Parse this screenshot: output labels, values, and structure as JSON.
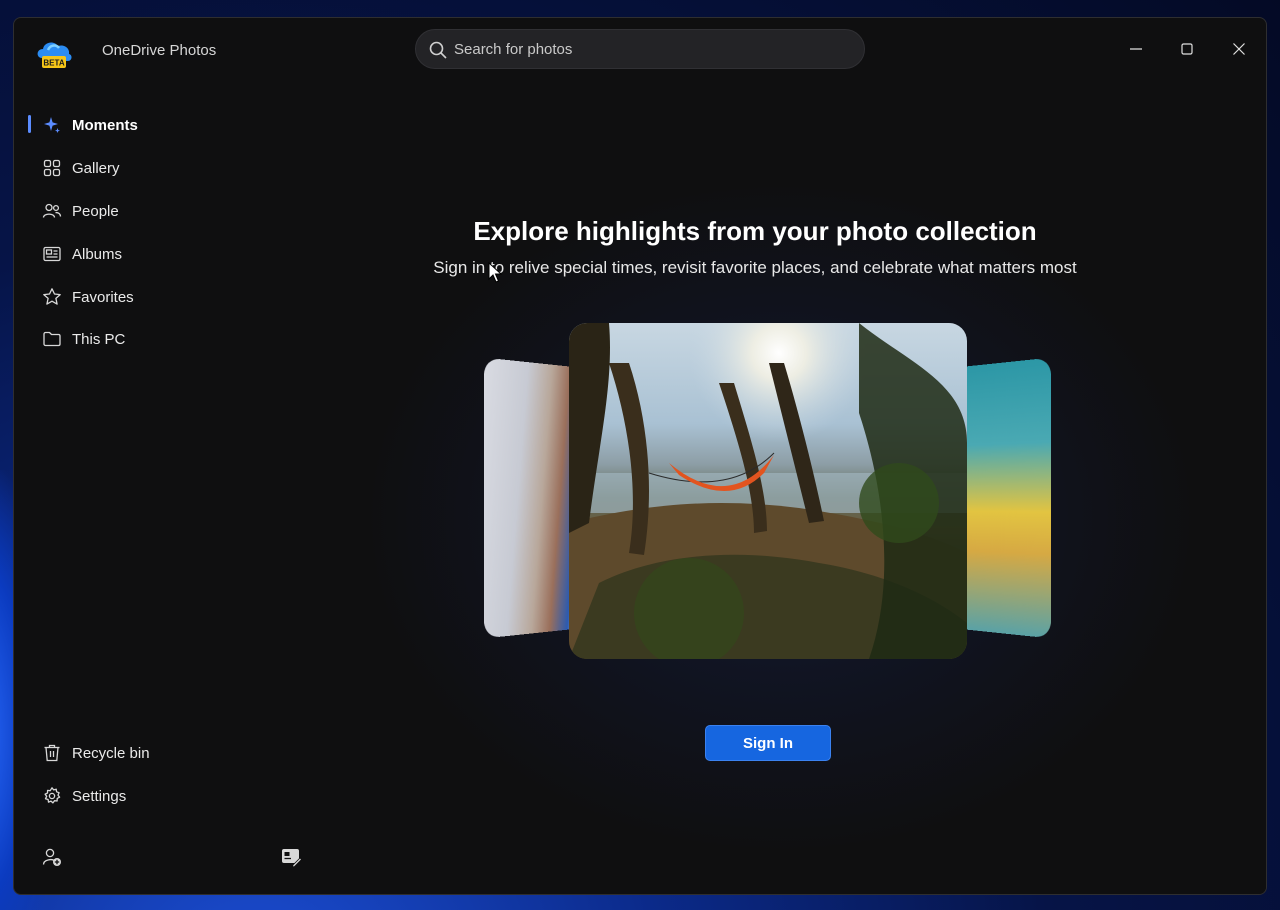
{
  "app": {
    "title": "OneDrive Photos",
    "badge": "BETA"
  },
  "search": {
    "placeholder": "Search for photos"
  },
  "window_controls": {
    "minimize_icon": "minimize-icon",
    "maximize_icon": "maximize-icon",
    "close_icon": "close-icon"
  },
  "sidebar": {
    "items": [
      {
        "label": "Moments",
        "icon": "sparkle-icon",
        "active": true
      },
      {
        "label": "Gallery",
        "icon": "grid-icon"
      },
      {
        "label": "People",
        "icon": "people-icon"
      },
      {
        "label": "Albums",
        "icon": "album-icon"
      },
      {
        "label": "Favorites",
        "icon": "star-icon"
      },
      {
        "label": "This PC",
        "icon": "folder-icon"
      }
    ],
    "bottom_items": [
      {
        "label": "Recycle bin",
        "icon": "trash-icon"
      },
      {
        "label": "Settings",
        "icon": "gear-icon"
      }
    ],
    "footer_icons": [
      "add-account-icon",
      "feedback-icon"
    ]
  },
  "hero": {
    "title": "Explore highlights from your photo collection",
    "subtitle": "Sign in to relive special times, revisit favorite places, and celebrate what matters most",
    "button_label": "Sign In"
  },
  "colors": {
    "accent": "#1666e0",
    "active_indicator": "#5b8cff",
    "window_bg": "#0f0f10"
  }
}
